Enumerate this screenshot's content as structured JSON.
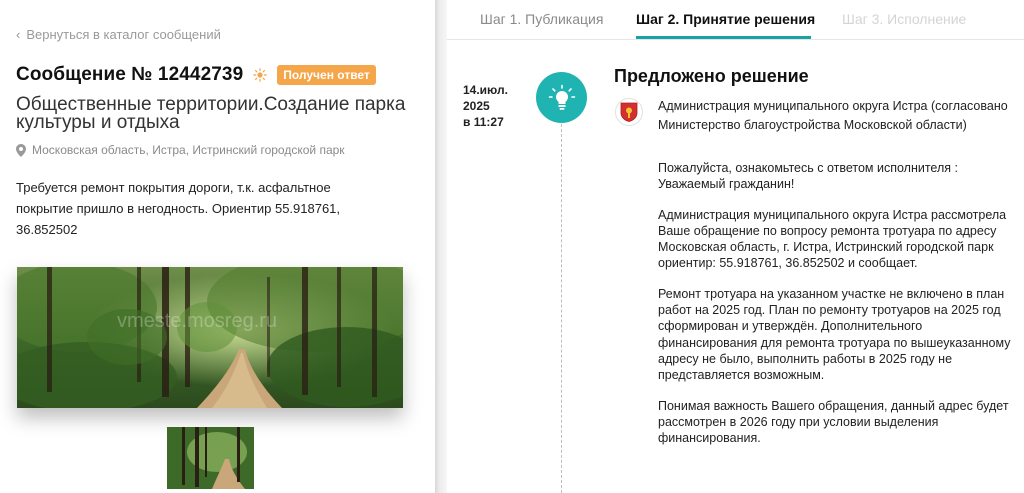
{
  "left": {
    "back_link": "Вернуться в каталог сообщений",
    "message_title": "Сообщение № 12442739",
    "status_badge": "Получен ответ",
    "category": "Общественные территории.Создание парка культуры и отдыха",
    "address": "Московская область, Истра, Истринский городской парк",
    "description": "Требуется ремонт покрытия дороги, т.к. асфальтное покрытие пришло в негодность. Ориентир 55.918761, 36.852502",
    "photo_watermark": "vmeste.mosreg.ru"
  },
  "tabs": [
    {
      "label": "Шаг 1. Публикация",
      "state": "normal"
    },
    {
      "label": "Шаг 2. Принятие решения",
      "state": "active"
    },
    {
      "label": "Шаг 3. Исполнение",
      "state": "disabled"
    }
  ],
  "timeline": {
    "date": "14.июл.",
    "year": "2025",
    "time": "в 11:27",
    "icon": "lightbulb-icon"
  },
  "decision": {
    "title": "Предложено решение",
    "org": "Администрация муниципального округа Истра (согласовано Министерство благоустройства Московской области)",
    "paragraphs": [
      "Пожалуйста, ознакомьтесь с ответом исполнителя : Уважаемый гражданин!",
      "Администрация муниципального округа Истра рассмотрела Ваше обращение по вопросу ремонта тротуара по адресу Московская область, г. Истра, Истринский городской парк ориентир: 55.918761, 36.852502  и сообщает.",
      "Ремонт  тротуара на указанном участке не включено в план работ на 2025 год.  План по ремонту тротуаров на 2025 год сформирован и утверждён. Дополнительного финансирования для ремонта тротуара по вышеуказанному адресу не было, выполнить работы в 2025 году не представляется возможным.",
      "Понимая важность Вашего обращения, данный адрес будет рассмотрен в 2026 году при условии выделения финансирования."
    ]
  },
  "colors": {
    "accent": "#1fb3b1",
    "badge": "#f5a54a",
    "tab_underline": "#1aa3a3"
  }
}
